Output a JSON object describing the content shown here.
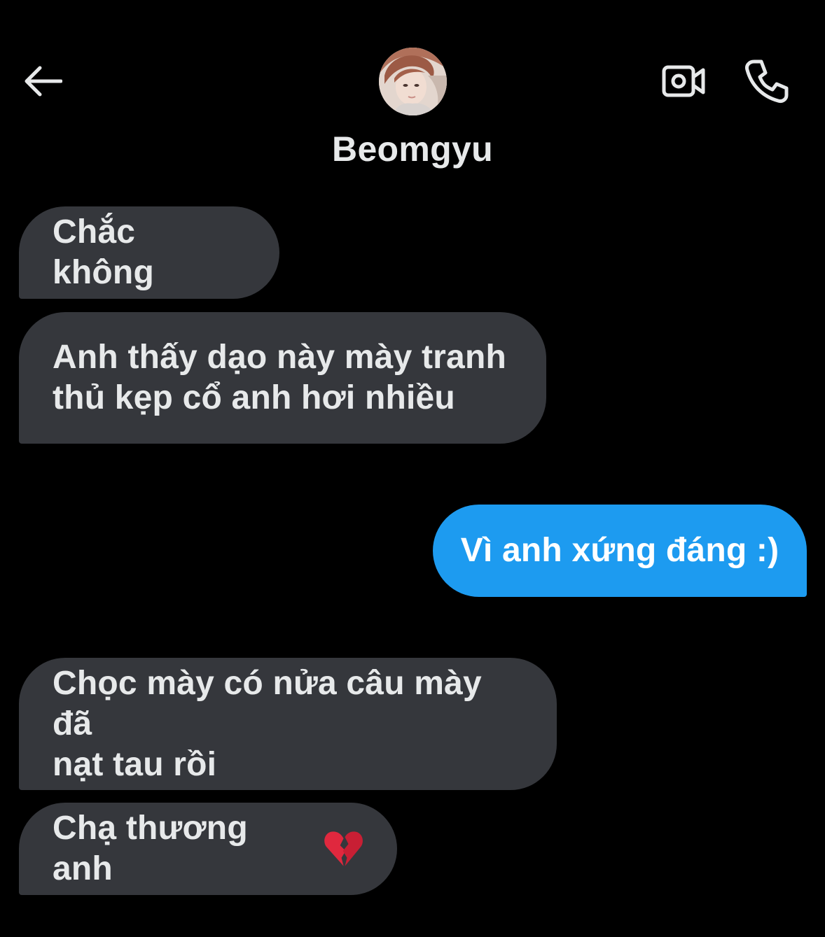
{
  "header": {
    "contact_name": "Beomgyu",
    "back_icon": "arrow-left-icon",
    "video_icon": "video-camera-icon",
    "call_icon": "phone-icon"
  },
  "messages": [
    {
      "direction": "incoming",
      "text": "Chắc không"
    },
    {
      "direction": "incoming",
      "text": "Anh thấy dạo này mày tranh\nthủ kẹp cổ anh hơi nhiều"
    },
    {
      "direction": "outgoing",
      "text": "Vì anh xứng đáng :)"
    },
    {
      "direction": "incoming",
      "text": "Chọc mày có nửa câu mày đã\nnạt tau rồi"
    },
    {
      "direction": "incoming",
      "text": "Chạ thương anh",
      "emoji": "broken-heart-icon"
    }
  ],
  "colors": {
    "background": "#000000",
    "incoming_bubble": "#35373c",
    "outgoing_bubble": "#1d9bf0",
    "text": "#e7e9ea"
  }
}
